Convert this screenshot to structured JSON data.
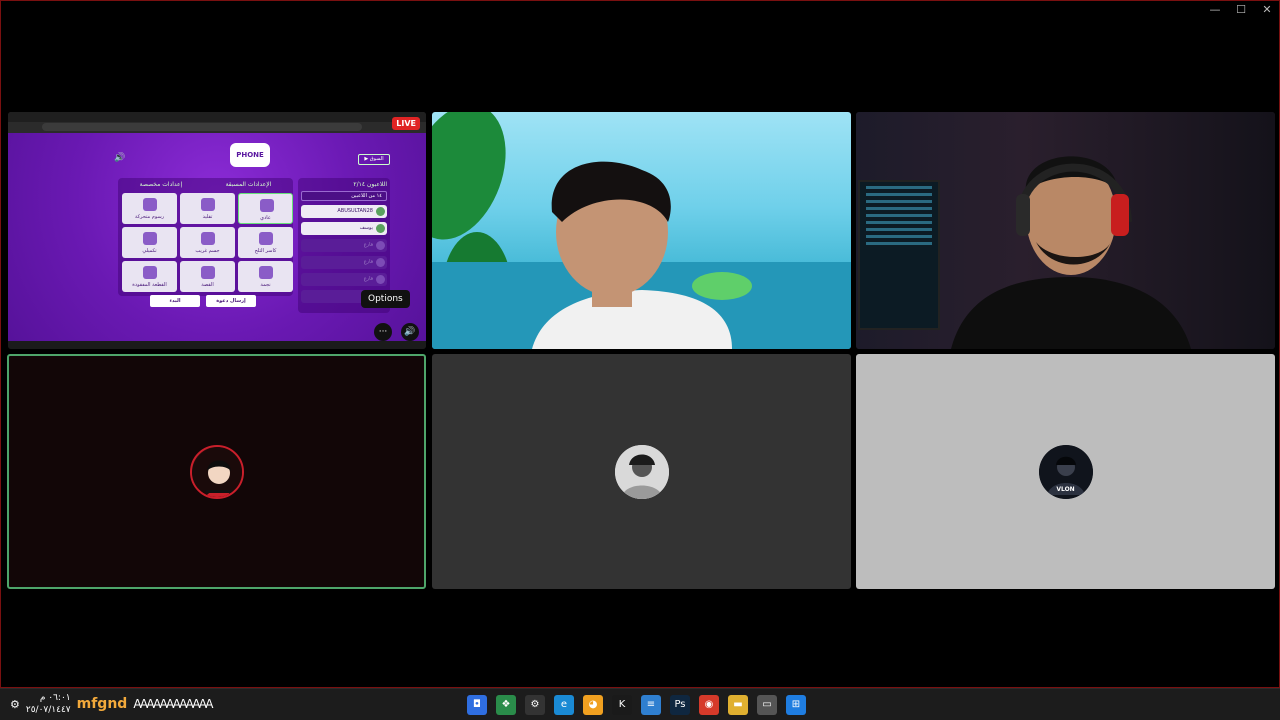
{
  "window": {
    "controls": [
      "—",
      "☐",
      "✕"
    ]
  },
  "screenshare": {
    "live_badge": "LIVE",
    "game": {
      "logo": "PHONE",
      "back_button": "▶ السوق",
      "sound_icon": "🔊",
      "panel_headers": [
        "إعدادات مخصصة",
        "الإعدادات المسبقة"
      ],
      "modes": [
        {
          "label": "رسوم متحركة",
          "selected": false
        },
        {
          "label": "تقليد",
          "selected": false
        },
        {
          "label": "عادي",
          "selected": true
        },
        {
          "label": "تكميلي",
          "selected": false
        },
        {
          "label": "جسم غريب",
          "selected": false
        },
        {
          "label": "كاسر الثلج",
          "selected": false
        },
        {
          "label": "القطعة المفقودة",
          "selected": false
        },
        {
          "label": "القصة",
          "selected": false
        },
        {
          "label": "نجمة",
          "selected": false
        }
      ],
      "players_title": "اللاعبون ٢/١٤",
      "players_select": "١٤ من اللاعبين",
      "players": [
        {
          "name": "ABUSULTAN28",
          "state": "active"
        },
        {
          "name": "يوسف",
          "state": "active"
        },
        {
          "name": "فارغ",
          "state": "empty"
        },
        {
          "name": "فارغ",
          "state": "empty"
        },
        {
          "name": "فارغ",
          "state": "empty"
        },
        {
          "name": "فارغ",
          "state": "empty"
        }
      ],
      "start_button": "البدء",
      "invite_button": "إرسال دعوة"
    },
    "tooltip": "Options",
    "more_icon": "···",
    "volume_icon": "🔊"
  },
  "taskbar": {
    "clock_time": "٠٦:٠١ م",
    "clock_date": "٢٥/٠٧/١٤٤٧",
    "brand": "mfgnd",
    "deco": "AAAAAAAAAAAA",
    "apps": [
      {
        "name": "roblox",
        "glyph": "◘",
        "color": "#2f6ee0"
      },
      {
        "name": "app-green",
        "glyph": "❖",
        "color": "#2a8c4a"
      },
      {
        "name": "settings",
        "glyph": "⚙",
        "color": "#333333"
      },
      {
        "name": "edge",
        "glyph": "e",
        "color": "#1a8ad4"
      },
      {
        "name": "discord",
        "glyph": "◕",
        "color": "#f0a020"
      },
      {
        "name": "kick",
        "glyph": "K",
        "color": "#1a1a1a"
      },
      {
        "name": "notepad",
        "glyph": "≡",
        "color": "#2f7fd0"
      },
      {
        "name": "photoshop",
        "glyph": "Ps",
        "color": "#0f2740"
      },
      {
        "name": "chrome",
        "glyph": "◉",
        "color": "#d63a2a"
      },
      {
        "name": "explorer",
        "glyph": "▬",
        "color": "#e0b030"
      },
      {
        "name": "terminal",
        "glyph": "▭",
        "color": "#555555"
      },
      {
        "name": "start",
        "glyph": "⊞",
        "color": "#1f7de0"
      }
    ]
  },
  "avatars": {
    "av3_label": "VLON"
  },
  "colors": {
    "speaking_border": "#4ea56a",
    "live_red": "#e02424",
    "game_purple": "#6a19b3"
  }
}
